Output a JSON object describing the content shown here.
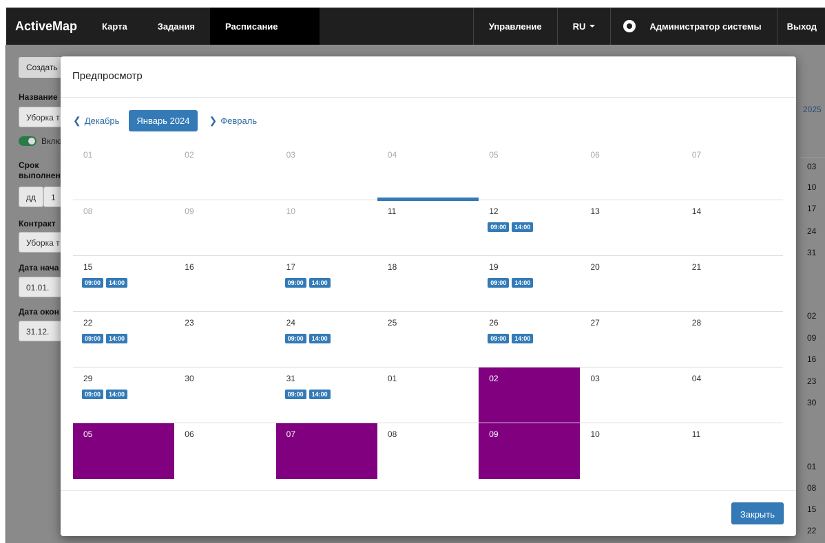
{
  "navbar": {
    "brand": "ActiveMap",
    "items": [
      "Карта",
      "Задания",
      "Расписание"
    ],
    "active_item": "Расписание",
    "right": {
      "manage": "Управление",
      "lang": "RU",
      "user": "Администратор системы",
      "logout": "Выход"
    }
  },
  "background": {
    "create_button": "Создать",
    "name_label": "Название",
    "name_value": "Уборка т",
    "toggle_label": "Вклю",
    "term_label_1": "Срок",
    "term_label_2": "выполнен",
    "term_unit": "дд",
    "term_value": "1",
    "contract_label": "Контракт",
    "contract_value": "Уборка т",
    "start_label": "Дата нача",
    "start_value": "01.01.",
    "end_label": "Дата окон",
    "end_value": "31.12.",
    "right_year": "2025",
    "right_numbers": [
      "03",
      "10",
      "17",
      "24",
      "31",
      "02",
      "09",
      "16",
      "23",
      "30",
      "01",
      "08",
      "15",
      "22"
    ]
  },
  "modal": {
    "title": "Предпросмотр",
    "prev_month": "Декабрь",
    "current_month": "Январь 2024",
    "next_month": "Февраль",
    "close_button": "Закрыть",
    "weeks": [
      [
        {
          "d": "01",
          "muted": true
        },
        {
          "d": "02",
          "muted": true
        },
        {
          "d": "03",
          "muted": true
        },
        {
          "d": "04",
          "muted": true
        },
        {
          "d": "05",
          "muted": true
        },
        {
          "d": "06",
          "muted": true
        },
        {
          "d": "07",
          "muted": true
        }
      ],
      [
        {
          "d": "08",
          "muted": true
        },
        {
          "d": "09",
          "muted": true
        },
        {
          "d": "10",
          "muted": true
        },
        {
          "d": "11",
          "today": true
        },
        {
          "d": "12",
          "badges": [
            "09:00",
            "14:00"
          ]
        },
        {
          "d": "13"
        },
        {
          "d": "14"
        }
      ],
      [
        {
          "d": "15",
          "badges": [
            "09:00",
            "14:00"
          ]
        },
        {
          "d": "16"
        },
        {
          "d": "17",
          "badges": [
            "09:00",
            "14:00"
          ]
        },
        {
          "d": "18"
        },
        {
          "d": "19",
          "badges": [
            "09:00",
            "14:00"
          ]
        },
        {
          "d": "20"
        },
        {
          "d": "21"
        }
      ],
      [
        {
          "d": "22",
          "badges": [
            "09:00",
            "14:00"
          ]
        },
        {
          "d": "23"
        },
        {
          "d": "24",
          "badges": [
            "09:00",
            "14:00"
          ]
        },
        {
          "d": "25"
        },
        {
          "d": "26",
          "badges": [
            "09:00",
            "14:00"
          ]
        },
        {
          "d": "27"
        },
        {
          "d": "28"
        }
      ],
      [
        {
          "d": "29",
          "badges": [
            "09:00",
            "14:00"
          ]
        },
        {
          "d": "30"
        },
        {
          "d": "31",
          "badges": [
            "09:00",
            "14:00"
          ]
        },
        {
          "d": "01"
        },
        {
          "d": "02",
          "purple": true
        },
        {
          "d": "03"
        },
        {
          "d": "04"
        }
      ],
      [
        {
          "d": "05",
          "purple": true
        },
        {
          "d": "06"
        },
        {
          "d": "07",
          "purple": true
        },
        {
          "d": "08"
        },
        {
          "d": "09",
          "purple": true
        },
        {
          "d": "10"
        },
        {
          "d": "11"
        }
      ]
    ]
  },
  "colors": {
    "accent": "#337ab7",
    "highlight": "#800080",
    "navbar": "#1f1f1f"
  }
}
